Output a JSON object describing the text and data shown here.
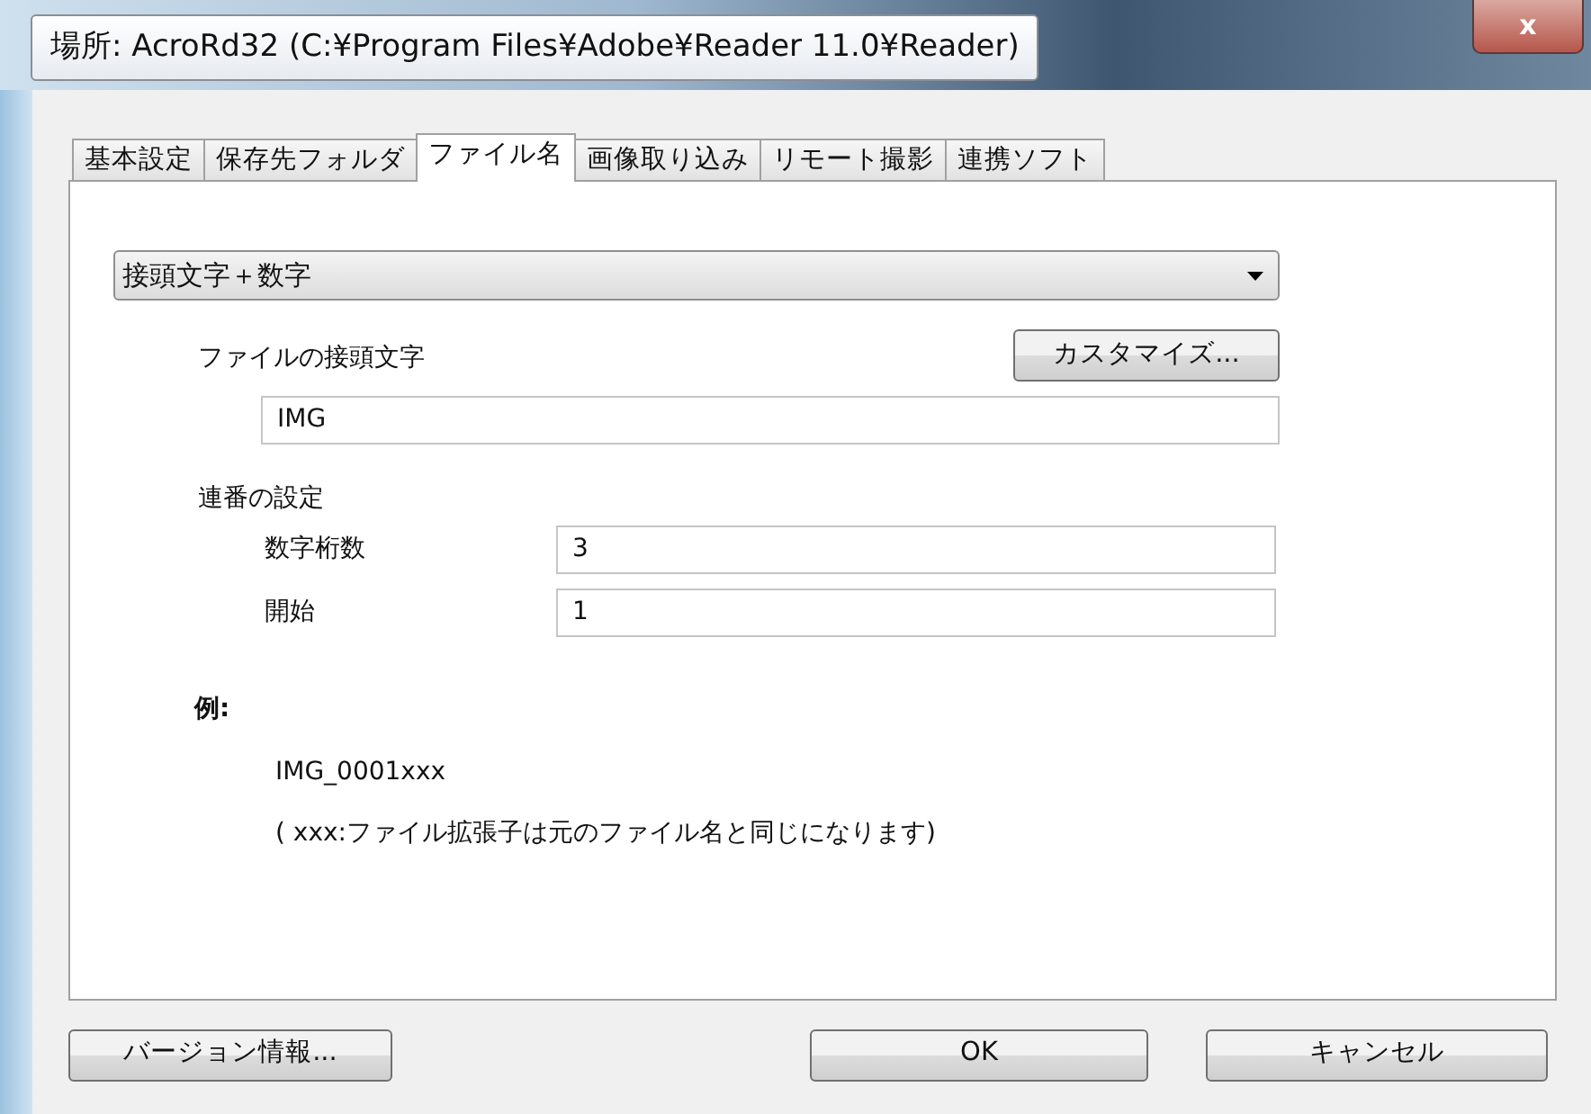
{
  "tooltip": "場所: AcroRd32 (C:¥Program Files¥Adobe¥Reader 11.0¥Reader)",
  "close_button": "x",
  "tabs": [
    {
      "label": "基本設定",
      "selected": false
    },
    {
      "label": "保存先フォルダ",
      "selected": false
    },
    {
      "label": "ファイル名",
      "selected": true
    },
    {
      "label": "画像取り込み",
      "selected": false
    },
    {
      "label": "リモート撮影",
      "selected": false
    },
    {
      "label": "連携ソフト",
      "selected": false
    }
  ],
  "format_dropdown": {
    "value": "接頭文字＋数字"
  },
  "customize_button": "カスタマイズ...",
  "prefix": {
    "label": "ファイルの接頭文字",
    "value": "IMG"
  },
  "numbering": {
    "heading": "連番の設定",
    "fields": [
      {
        "label": "数字桁数",
        "value": "3"
      },
      {
        "label": "開始",
        "value": "1"
      }
    ]
  },
  "example": {
    "label": "例:",
    "value": "IMG_0001xxx",
    "note": "( xxx:ファイル拡張子は元のファイル名と同じになります)"
  },
  "buttons": {
    "version": "バージョン情報...",
    "ok": "OK",
    "cancel": "キャンセル"
  }
}
